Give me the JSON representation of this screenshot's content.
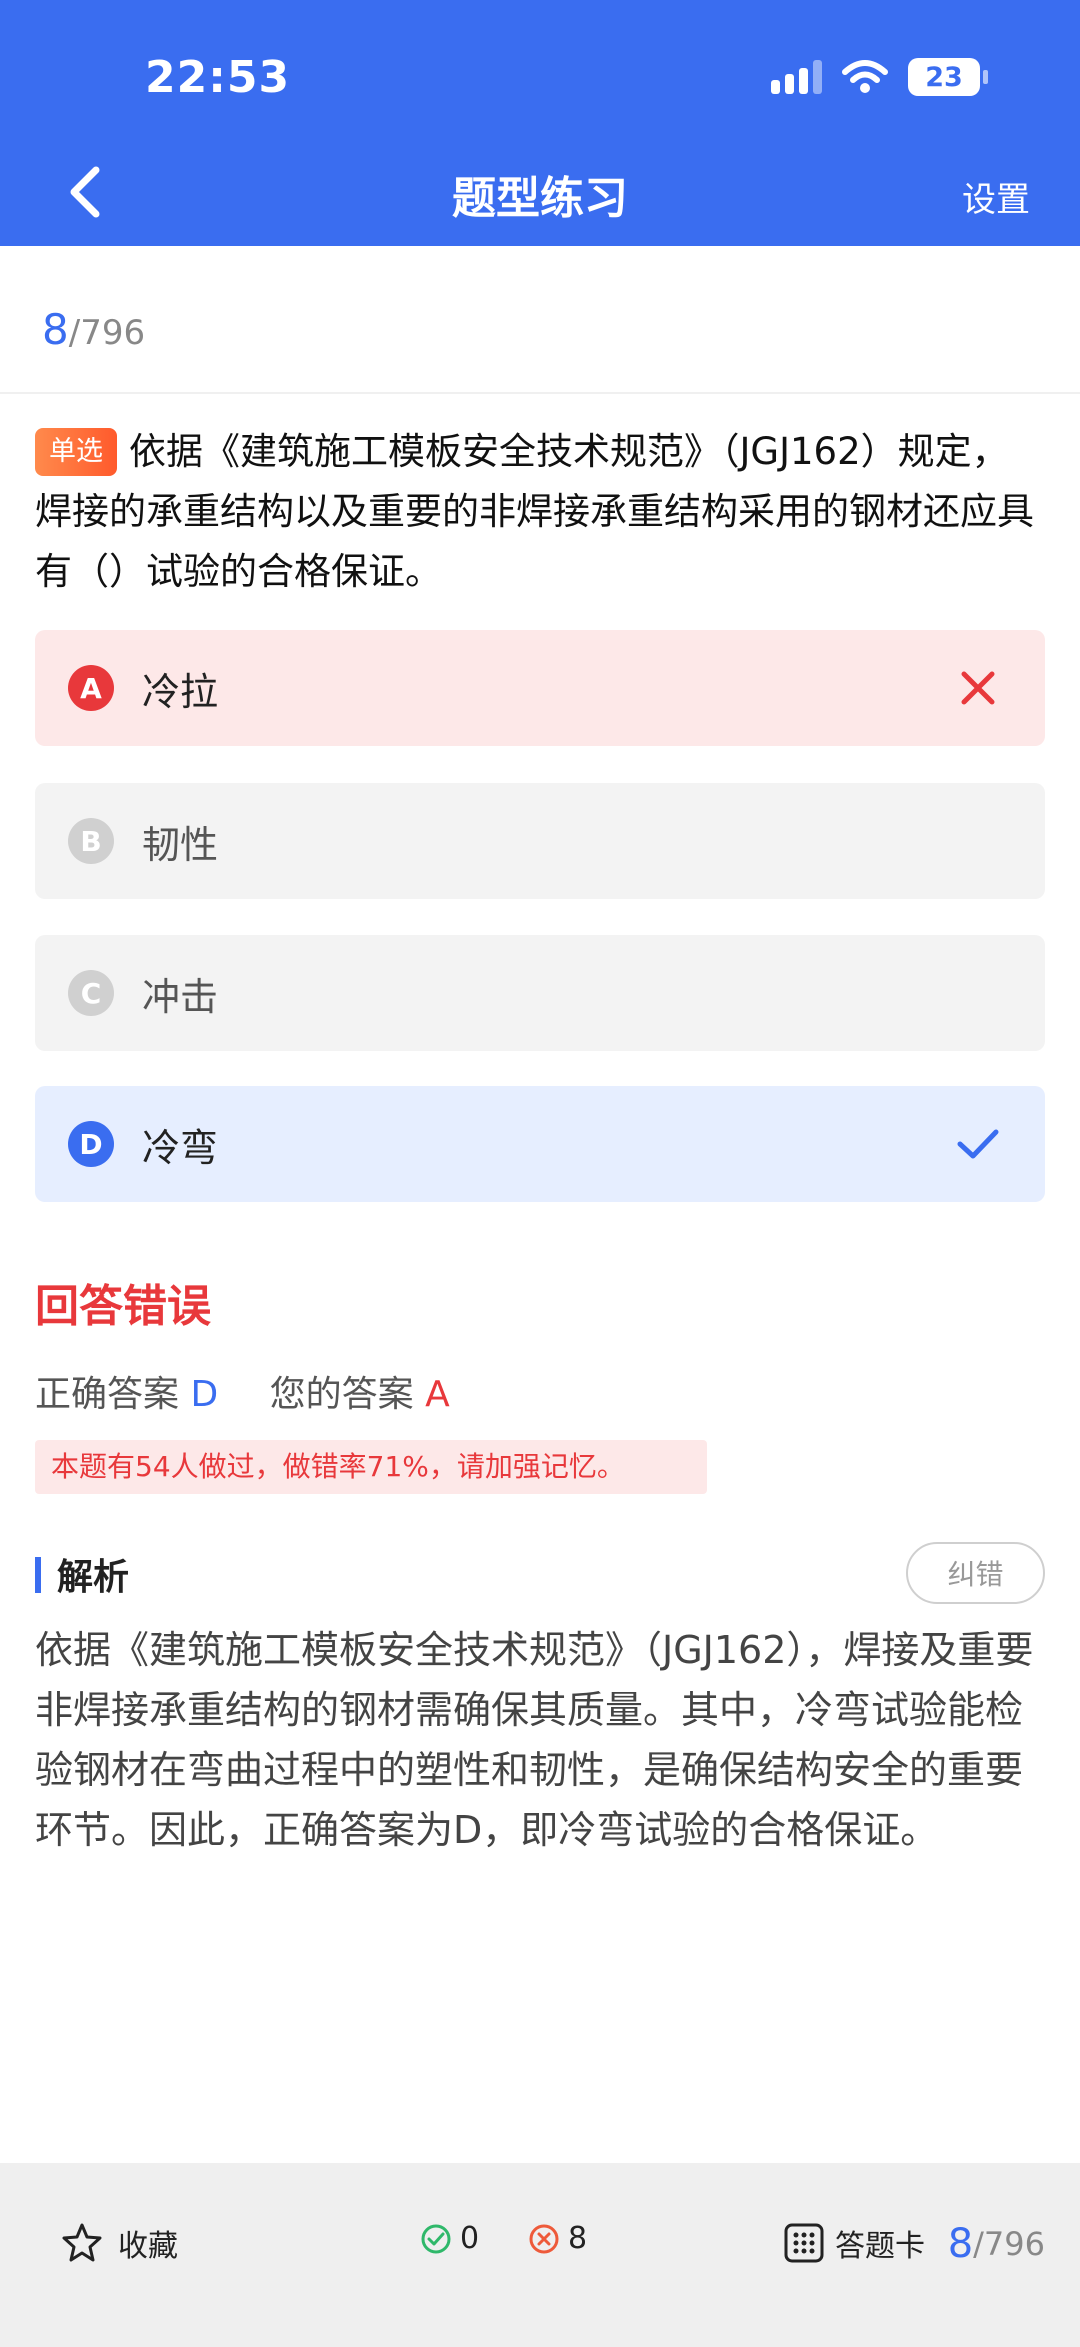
{
  "status": {
    "time": "22:53",
    "battery": "23"
  },
  "nav": {
    "title": "题型练习",
    "settings": "设置"
  },
  "progress": {
    "current": "8",
    "total": "/796"
  },
  "question": {
    "type_tag": "单选",
    "text": "依据《建筑施工模板安全技术规范》（JGJ162）规定，焊接的承重结构以及重要的非焊接承重结构采用的钢材还应具有（）试验的合格保证。"
  },
  "options": [
    {
      "letter": "A",
      "text": "冷拉",
      "state": "wrong"
    },
    {
      "letter": "B",
      "text": "韧性",
      "state": "neutral"
    },
    {
      "letter": "C",
      "text": "冲击",
      "state": "neutral"
    },
    {
      "letter": "D",
      "text": "冷弯",
      "state": "correct"
    }
  ],
  "result": {
    "title": "回答错误",
    "correct_label": "正确答案",
    "correct_value": "D",
    "yours_label": "您的答案",
    "yours_value": "A",
    "note": "本题有54人做过，做错率71%，请加强记忆。"
  },
  "analysis": {
    "title": "解析",
    "report_button": "纠错",
    "text": "依据《建筑施工模板安全技术规范》（JGJ162），焊接及重要非焊接承重结构的钢材需确保其质量。其中，冷弯试验能检验钢材在弯曲过程中的塑性和韧性，是确保结构安全的重要环节。因此，正确答案为D，即冷弯试验的合格保证。"
  },
  "bottom": {
    "favorite": "收藏",
    "right_count": "0",
    "wrong_count": "8",
    "answer_card": "答题卡",
    "progress_current": "8",
    "progress_total": "/796"
  },
  "colors": {
    "brand": "#3a6df0",
    "error": "#e8383b"
  }
}
